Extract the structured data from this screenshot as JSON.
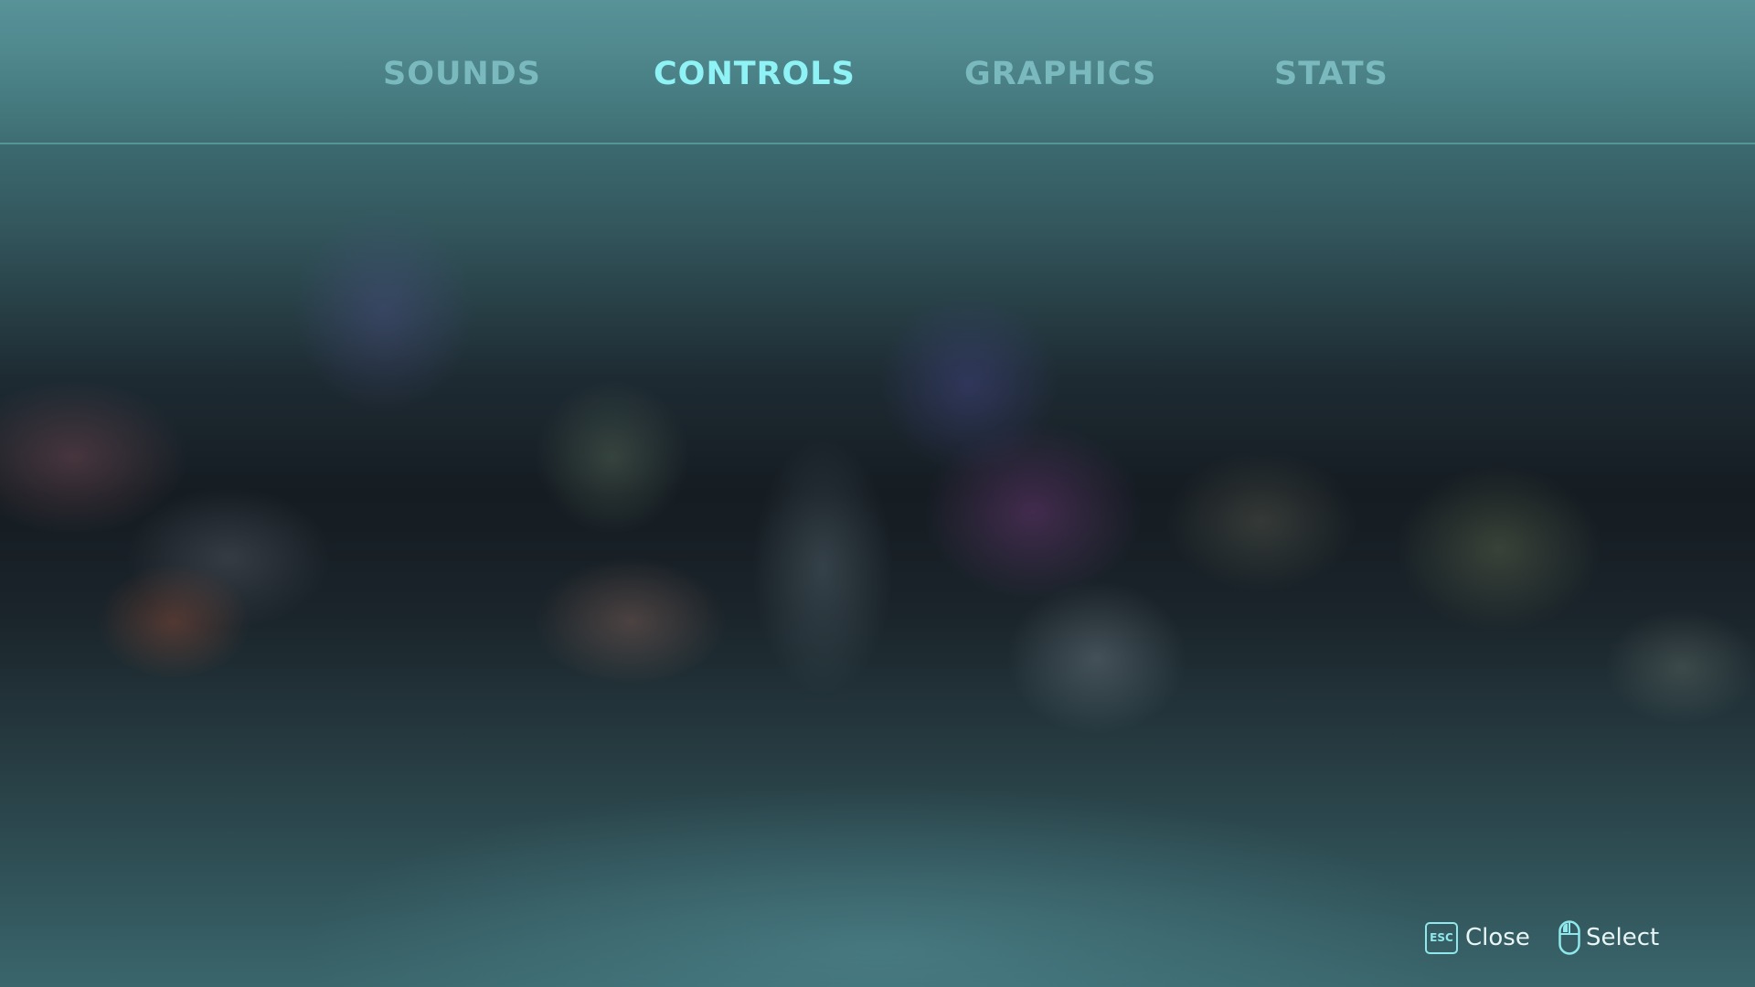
{
  "tabs": [
    {
      "label": "SOUNDS",
      "active": false
    },
    {
      "label": "CONTROLS",
      "active": true
    },
    {
      "label": "GRAPHICS",
      "active": false
    },
    {
      "label": "STATS",
      "active": false
    }
  ],
  "hints": {
    "close": {
      "key": "ESC",
      "label": "Close",
      "icon": "esc-key-icon"
    },
    "select": {
      "label": "Select",
      "icon": "mouse-left-click-icon"
    }
  },
  "colors": {
    "tab_inactive": "#7ab9bd",
    "tab_active": "#8ff2f4",
    "divider": "#5fa3a6",
    "hint_text": "#e8f6f6",
    "hint_icon": "#8fe8ec"
  }
}
